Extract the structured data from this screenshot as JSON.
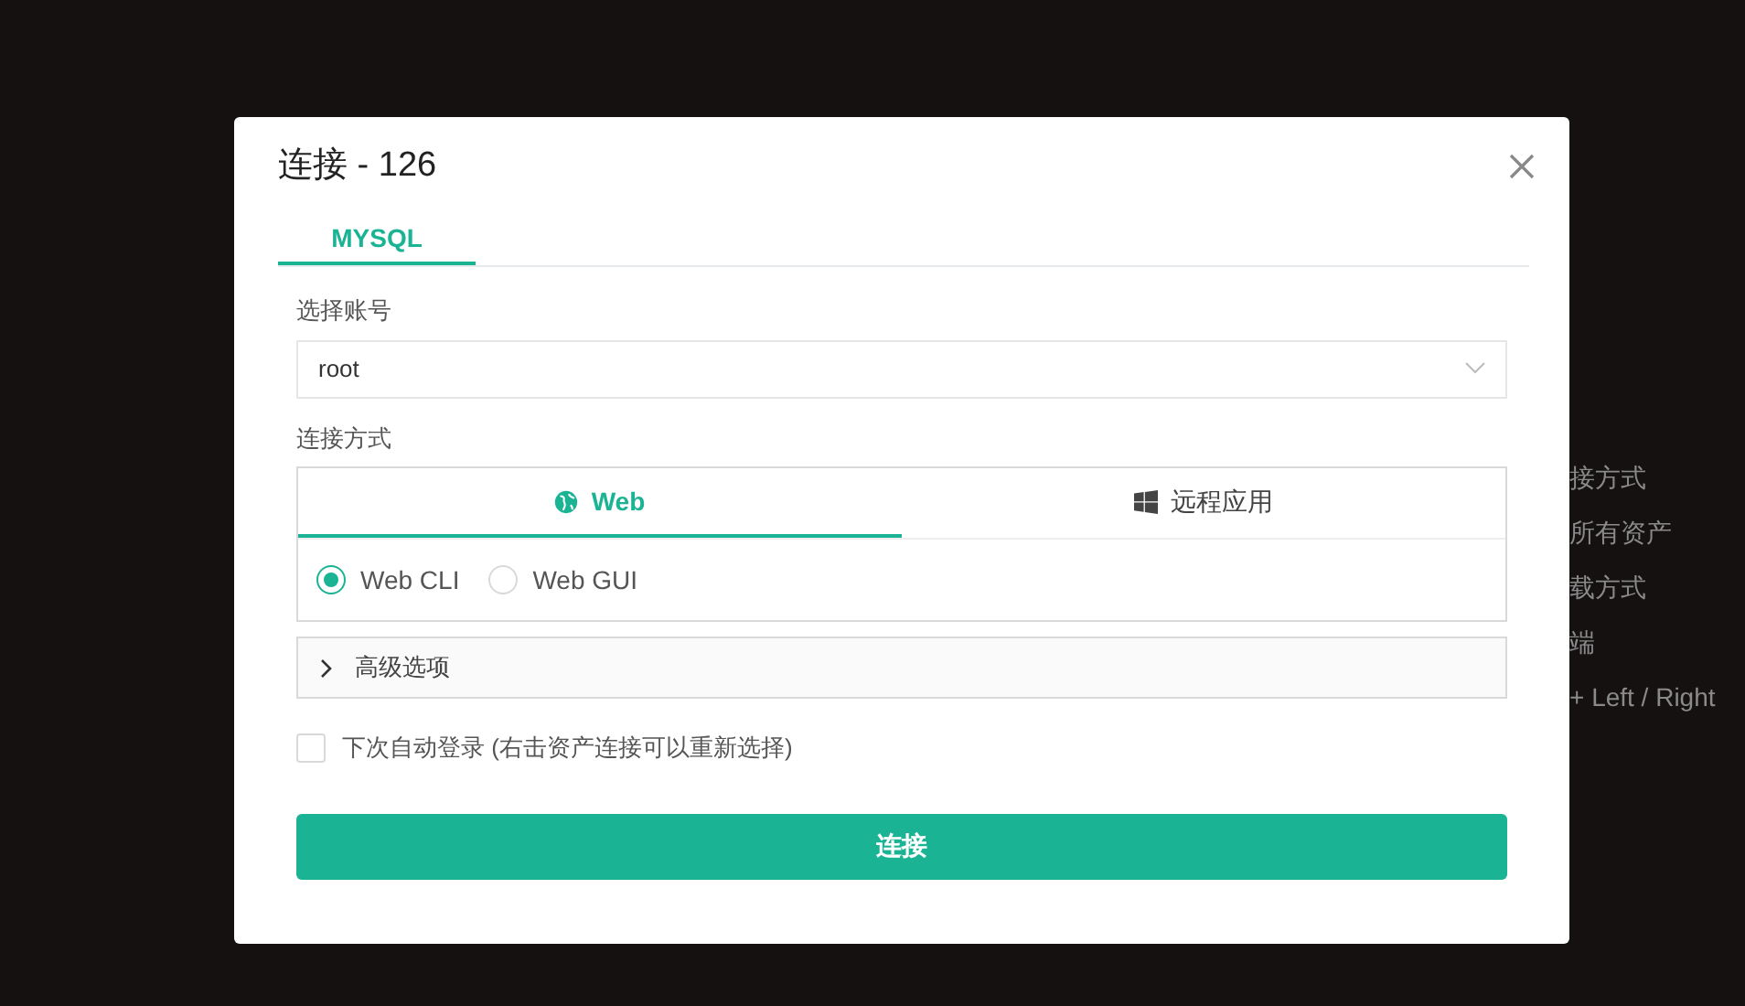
{
  "background_items": [
    "接方式",
    "所有资产",
    "载方式",
    "端",
    "+ Left / Right"
  ],
  "dialog": {
    "title": "连接 - 126",
    "tabs": [
      {
        "label": "MYSQL",
        "selected": true
      }
    ],
    "account": {
      "label": "选择账号",
      "value": "root"
    },
    "method": {
      "label": "连接方式",
      "tabs": [
        {
          "label": "Web",
          "kind": "web",
          "selected": true
        },
        {
          "label": "远程应用",
          "kind": "windows",
          "selected": false
        }
      ],
      "options": [
        {
          "label": "Web CLI",
          "selected": true
        },
        {
          "label": "Web GUI",
          "selected": false
        }
      ]
    },
    "advanced": {
      "label": "高级选项",
      "expanded": false
    },
    "auto_login": {
      "label": "下次自动登录 (右击资产连接可以重新选择)",
      "checked": false
    },
    "connect_button": "连接"
  }
}
